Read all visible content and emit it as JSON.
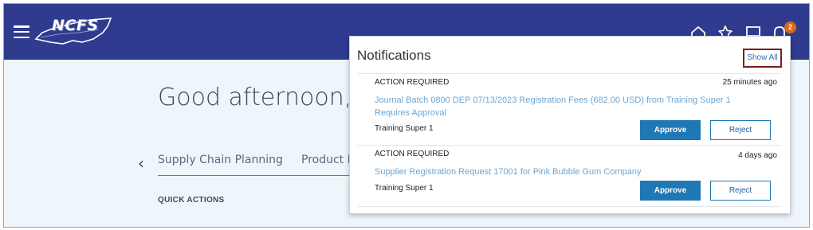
{
  "header": {
    "logo_text": "NCFS",
    "notifications_count": "2",
    "icons": [
      "menu-icon",
      "home-icon",
      "star-icon",
      "board-icon",
      "bell-icon"
    ]
  },
  "main": {
    "greeting": "Good afternoon, Tra",
    "tabs": [
      {
        "label": "Supply Chain Planning"
      },
      {
        "label": "Product M"
      }
    ],
    "quick_actions_label": "QUICK ACTIONS"
  },
  "notifications": {
    "title": "Notifications",
    "show_all_label": "Show All",
    "items": [
      {
        "status": "ACTION REQUIRED",
        "time": "25 minutes ago",
        "message": "Journal Batch 0800 DEP 07/13/2023 Registration Fees (682.00 USD) from Training Super 1 Requires Approval",
        "from": "Training Super 1",
        "approve_label": "Approve",
        "reject_label": "Reject"
      },
      {
        "status": "ACTION REQUIRED",
        "time": "4 days ago",
        "message": "Supplier Registration Request 17001 for Pink Bubble Gum Company",
        "from": "Training Super 1",
        "approve_label": "Approve",
        "reject_label": "Reject"
      }
    ]
  },
  "colors": {
    "header_bg": "#2f3b8e",
    "page_bg": "#eef5fb",
    "badge": "#e0661a",
    "primary_button": "#1f78b4",
    "link": "#6aa6d6",
    "show_all_border": "#7a1d1d"
  }
}
